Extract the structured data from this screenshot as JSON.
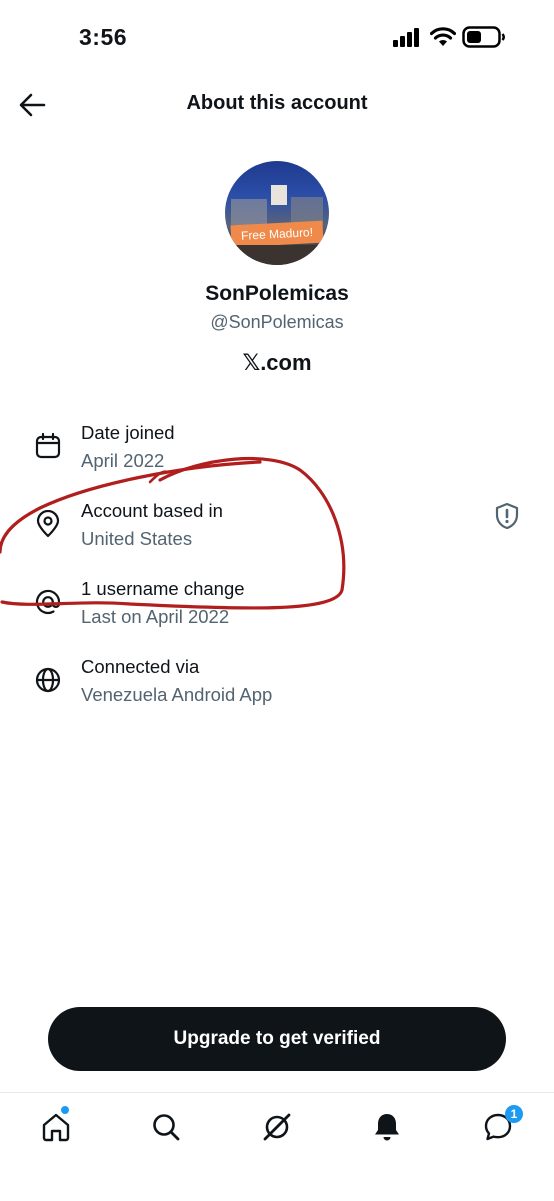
{
  "status_bar": {
    "time": "3:56"
  },
  "header": {
    "title": "About this account"
  },
  "profile": {
    "display_name": "SonPolemicas",
    "handle": "@SonPolemicas",
    "site_glyph": "𝕏",
    "site_suffix": ".com",
    "avatar_banner_text": "Free Maduro!"
  },
  "details": [
    {
      "icon": "calendar-icon",
      "label": "Date joined",
      "value": "April 2022"
    },
    {
      "icon": "location-pin-icon",
      "label": "Account based in",
      "value": "United States"
    },
    {
      "icon": "at-sign-icon",
      "label": "1 username change",
      "value": "Last on April 2022"
    },
    {
      "icon": "globe-icon",
      "label": "Connected via",
      "value": "Venezuela Android App"
    }
  ],
  "cta": {
    "label": "Upgrade to get verified"
  },
  "tabbar": {
    "tabs": [
      "home",
      "search",
      "grok",
      "notifications",
      "messages"
    ],
    "messages_badge": "1"
  },
  "colors": {
    "text_primary": "#0f1419",
    "text_secondary": "#536471",
    "accent": "#1d9bf0",
    "annotation": "#b01e1e"
  }
}
